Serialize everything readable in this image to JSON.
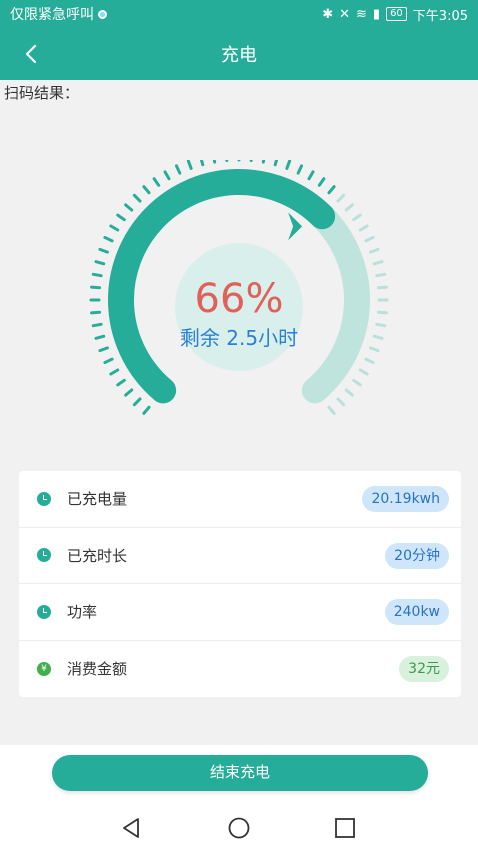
{
  "status_bar": {
    "carrier": "仅限紧急呼叫",
    "battery": "60",
    "time": "下午3:05"
  },
  "header": {
    "title": "充电"
  },
  "scan_label": "扫码结果：",
  "gauge": {
    "percent": 66,
    "percent_text": "66%",
    "remaining_text": "剩余 2.5小时"
  },
  "stats": [
    {
      "label": "已充电量",
      "value": "20.19kwh",
      "icon": "clock-icon"
    },
    {
      "label": "已充时长",
      "value": "20分钟",
      "icon": "clock-icon"
    },
    {
      "label": "功率",
      "value": "240kw",
      "icon": "clock-icon"
    },
    {
      "label": "消费金额",
      "value": "32元",
      "icon": "yen-icon"
    }
  ],
  "end_button": "结束充电",
  "colors": {
    "primary": "#25ad9a",
    "percent": "#e2605a",
    "remain": "#2b7fd6",
    "badge_blue_bg": "#cfe6fa",
    "badge_green_bg": "#d8f1dc"
  }
}
